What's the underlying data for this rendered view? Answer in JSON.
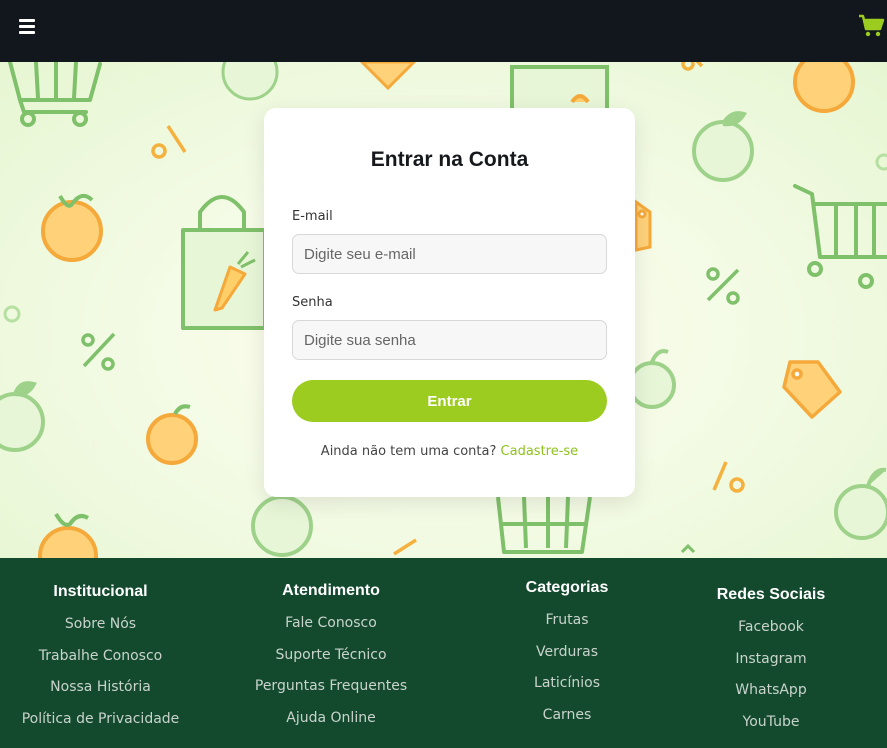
{
  "header": {
    "menu_icon": "hamburger-menu-icon",
    "cart_icon": "shopping-cart-icon",
    "accent_color": "#9bcc1f",
    "background_color": "#12161d"
  },
  "login": {
    "title": "Entrar na Conta",
    "email_label": "E-mail",
    "email_placeholder": "Digite seu e-mail",
    "email_value": "",
    "password_label": "Senha",
    "password_placeholder": "Digite sua senha",
    "password_value": "",
    "submit_label": "Entrar",
    "signup_prompt": "Ainda não tem uma conta?",
    "signup_link": "Cadastre-se"
  },
  "footer": {
    "background_color": "#134a2e",
    "columns": [
      {
        "title": "Institucional",
        "links": [
          "Sobre Nós",
          "Trabalhe Conosco",
          "Nossa História",
          "Política de Privacidade"
        ]
      },
      {
        "title": "Atendimento",
        "links": [
          "Fale Conosco",
          "Suporte Técnico",
          "Perguntas Frequentes",
          "Ajuda Online"
        ]
      },
      {
        "title": "Categorias",
        "links": [
          "Frutas",
          "Verduras",
          "Laticínios",
          "Carnes"
        ]
      },
      {
        "title": "Redes Sociais",
        "links": [
          "Facebook",
          "Instagram",
          "WhatsApp",
          "YouTube"
        ]
      }
    ]
  }
}
